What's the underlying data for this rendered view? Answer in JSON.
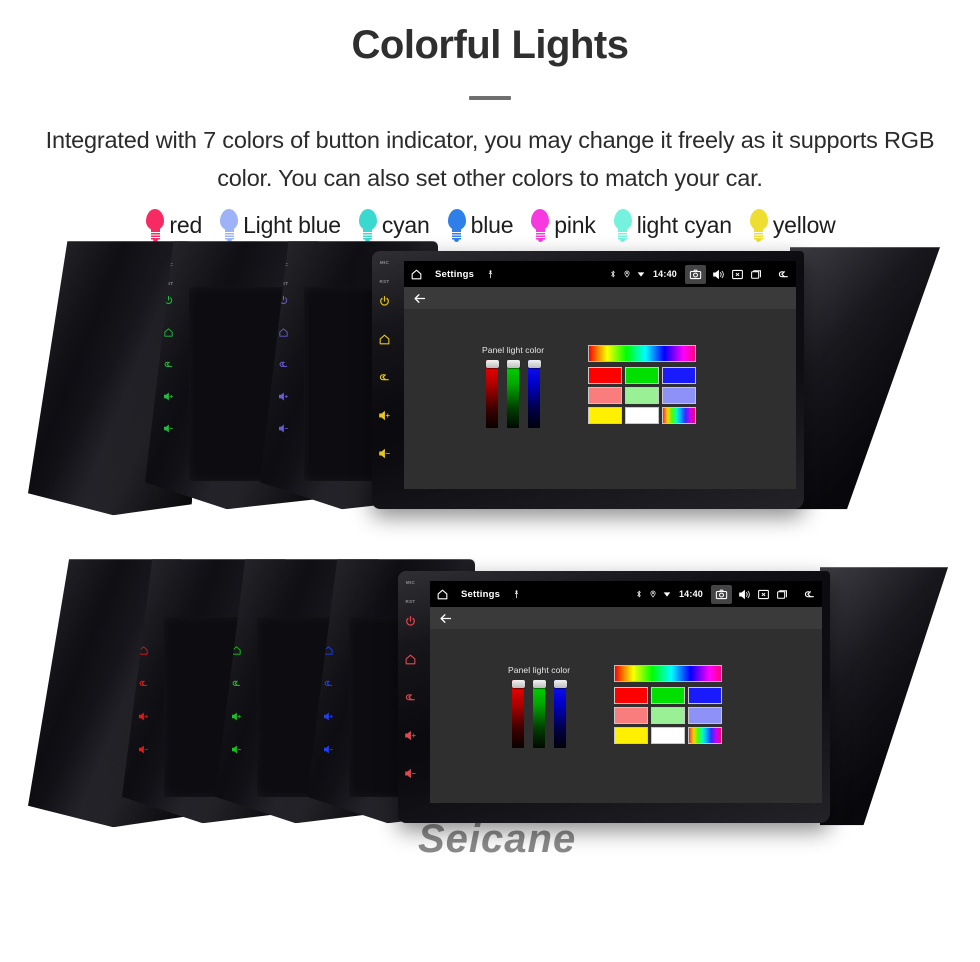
{
  "header": {
    "title": "Colorful Lights",
    "subtitle": "Integrated with 7 colors of button indicator, you may change it freely as it supports RGB color. You can also set other colors to match your car."
  },
  "legend": {
    "items": [
      {
        "label": "red",
        "color": "#f72b63",
        "icon": "bulb-icon"
      },
      {
        "label": "Light blue",
        "color": "#9eb3f7",
        "icon": "bulb-icon"
      },
      {
        "label": "cyan",
        "color": "#3ad9cf",
        "icon": "bulb-icon"
      },
      {
        "label": "blue",
        "color": "#2f7fe8",
        "icon": "bulb-icon"
      },
      {
        "label": "pink",
        "color": "#f73ae0",
        "icon": "bulb-icon"
      },
      {
        "label": "light cyan",
        "color": "#74f2dd",
        "icon": "bulb-icon"
      },
      {
        "label": "yellow",
        "color": "#eede32",
        "icon": "bulb-icon"
      }
    ]
  },
  "units": {
    "watermark": "Seicane",
    "top_group": {
      "led_colors": [
        "#1fbf3f",
        "#6a5bd8",
        "#e8c61a"
      ],
      "key_labels": {
        "mic": "MIC",
        "rst": "RST"
      },
      "keys": [
        {
          "name": "power-key",
          "icon": "power-icon"
        },
        {
          "name": "home-key",
          "icon": "home-icon"
        },
        {
          "name": "back-key",
          "icon": "back-arrow-icon"
        },
        {
          "name": "volume-up-key",
          "icon": "volume-up-icon"
        },
        {
          "name": "volume-down-key",
          "icon": "volume-down-icon"
        }
      ]
    },
    "bottom_group": {
      "led_colors": [
        "#e01a1a",
        "#18c41d",
        "#1f3ff0",
        "#e0484e"
      ]
    }
  },
  "screen": {
    "statusbar": {
      "home_icon": "home-icon",
      "title": "Settings",
      "usb_icon": "usb-icon",
      "bluetooth_icon": "bluetooth-icon",
      "location_icon": "location-icon",
      "wifi_icon": "wifi-icon",
      "time": "14:40",
      "camera_icon": "camera-icon",
      "volume_icon": "volume-icon",
      "close_box_icon": "close-box-icon",
      "recents_icon": "recents-icon",
      "back_icon": "back-arrow-icon"
    },
    "actionbar": {
      "back_icon": "back-arrow-icon"
    },
    "panel_light_color": {
      "caption": "Panel light color",
      "sliders": [
        {
          "name": "red-slider",
          "channel": "R",
          "value_pct": 100
        },
        {
          "name": "green-slider",
          "channel": "G",
          "value_pct": 100
        },
        {
          "name": "blue-slider",
          "channel": "B",
          "value_pct": 100
        }
      ],
      "hue_bar": "hue-gradient-bar",
      "swatches": [
        {
          "name": "swatch-red",
          "color": "#ff0000"
        },
        {
          "name": "swatch-green",
          "color": "#00e000"
        },
        {
          "name": "swatch-blue",
          "color": "#1a1aff"
        },
        {
          "name": "swatch-salmon",
          "color": "#fa7d7d"
        },
        {
          "name": "swatch-lightgreen",
          "color": "#9af094"
        },
        {
          "name": "swatch-periwinkle",
          "color": "#8e92f7"
        },
        {
          "name": "swatch-yellow",
          "color": "#fff000"
        },
        {
          "name": "swatch-white",
          "color": "#ffffff"
        },
        {
          "name": "swatch-rainbow",
          "color": "rainbow"
        }
      ]
    }
  }
}
